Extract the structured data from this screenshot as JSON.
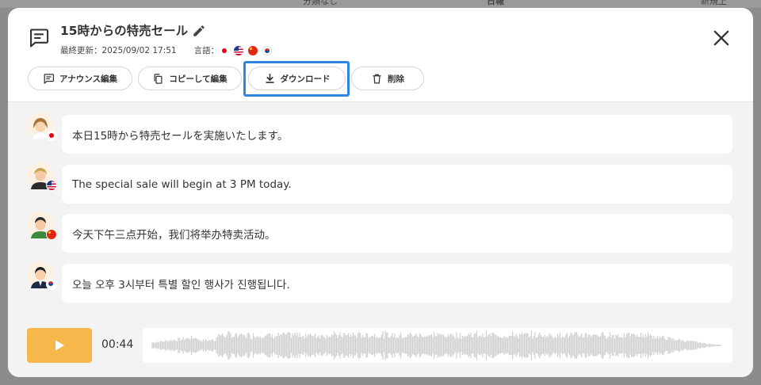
{
  "backdrop": {
    "left_label": "分類なし",
    "center_label": "日報",
    "right_label": "新規上"
  },
  "modal": {
    "title": "15時からの特売セール",
    "last_updated_label": "最終更新：",
    "last_updated": "2025/09/02 17:51",
    "languages_label": "言語：",
    "languages": [
      "ja",
      "en",
      "zh",
      "ko"
    ]
  },
  "toolbar": {
    "edit_label": "アナウンス編集",
    "copy_label": "コピーして編集",
    "download_label": "ダウンロード",
    "delete_label": "削除"
  },
  "messages": [
    {
      "lang": "ja",
      "text": "本日15時から特売セールを実施いたします。"
    },
    {
      "lang": "en",
      "text": "The special sale will begin at 3 PM today."
    },
    {
      "lang": "zh",
      "text": "今天下午三点开始，我们将举办特卖活动。"
    },
    {
      "lang": "ko",
      "text": "오늘 오후 3시부터 특별 할인 행사가 진행됩니다."
    }
  ],
  "player": {
    "duration": "00:44"
  },
  "colors": {
    "accent": "#f7b84b",
    "focus": "#2f86e0",
    "text": "#333333",
    "background": "#f3f3f3",
    "waveform": "#d2d2d2"
  },
  "icons": {
    "announcement": "message-icon",
    "edit": "pencil-icon",
    "close": "close-icon",
    "copy": "copy-icon",
    "download": "download-icon",
    "delete": "trash-icon",
    "play": "play-icon"
  }
}
